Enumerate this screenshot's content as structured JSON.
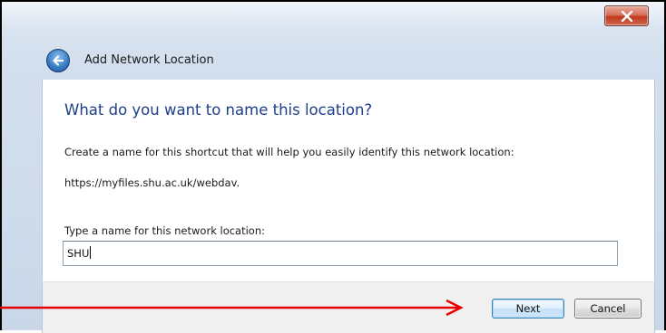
{
  "window": {
    "title": "Add Network Location",
    "close_glyph": "x"
  },
  "page": {
    "heading": "What do you want to name this location?",
    "description": "Create a name for this shortcut that will help you easily identify this network location:",
    "url": "https://myfiles.shu.ac.uk/webdav.",
    "field_label": "Type a name for this network location:",
    "field_value": "SHU"
  },
  "footer": {
    "next_label": "Next",
    "cancel_label": "Cancel"
  },
  "annotation": {
    "arrow_color": "#e60000",
    "arrow_target": "next-button"
  }
}
